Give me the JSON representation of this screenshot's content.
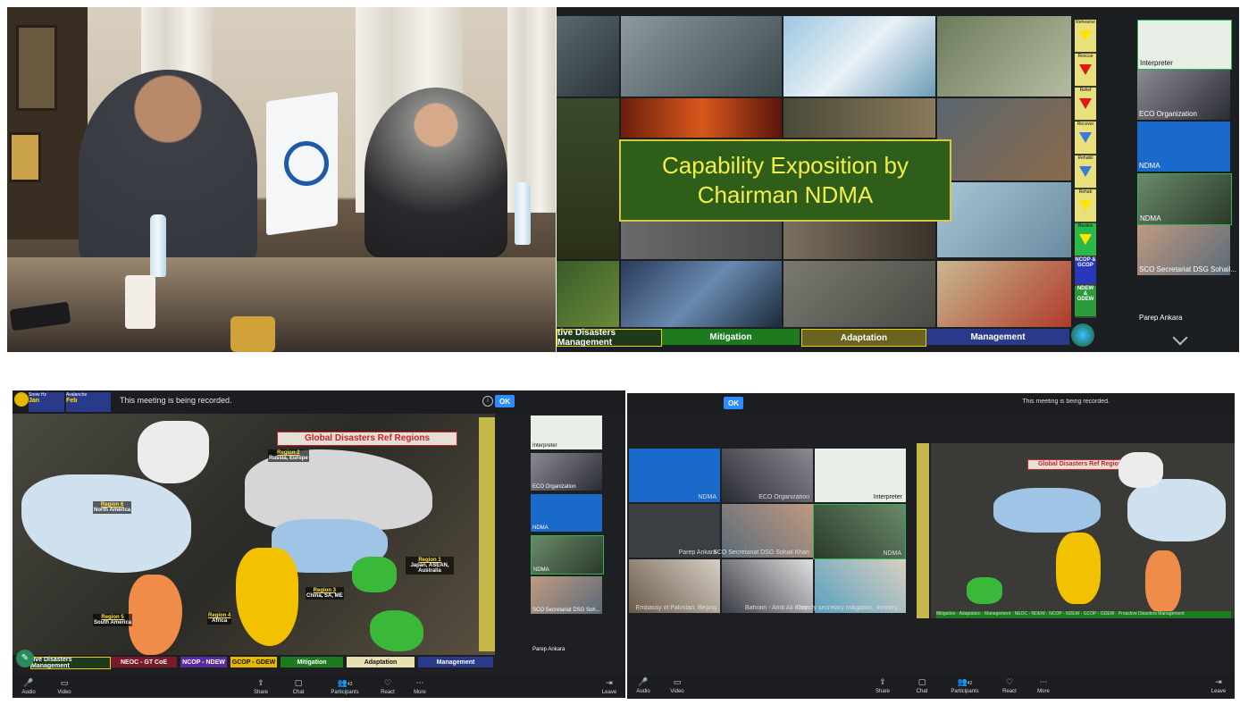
{
  "panel2": {
    "banner_line1": "Capability Exposition by",
    "banner_line2": "Chairman NDMA",
    "strip": [
      "Rehearse",
      "Rescue",
      "Relief",
      "Recover",
      "Rehabil",
      "Rehab",
      "Review",
      "NCOP & GCOP",
      "NDEW & GDEW"
    ],
    "categories": [
      "tive Disasters Management",
      "Mitigation",
      "Adaptation",
      "Management"
    ],
    "participants": [
      "Interpreter",
      "ECO Organization",
      "NDMA",
      "NDMA",
      "SCO Secretariat DSG Sohail...",
      "Parep Ankara"
    ]
  },
  "panel3": {
    "snow_label": "Snow Hz",
    "avalanche_label": "Avalanche",
    "month1": "Jan",
    "month2": "Feb",
    "recording_text": "This meeting is being recorded.",
    "ok_label": "OK",
    "map_title": "Global Disasters Ref Regions",
    "regions": [
      {
        "name": "Region 2",
        "desc": "Russia, Europe"
      },
      {
        "name": "Region 6",
        "desc": "North America"
      },
      {
        "name": "Region 1",
        "desc": "Japan, ASEAN, Australia"
      },
      {
        "name": "Region 3",
        "desc": "China, SA, ME"
      },
      {
        "name": "Region 5",
        "desc": "South America"
      },
      {
        "name": "Region 4",
        "desc": "Africa"
      }
    ],
    "bottom_categories": [
      "tive Disasters Management",
      "NEOC - GT CoE",
      "NCOP - NDEW",
      "GCOP - GDEW",
      "Mitigation",
      "Adaptation",
      "Management"
    ],
    "participants": [
      "Interpreter",
      "ECO Organization",
      "NDMA",
      "NDMA",
      "SCO Secretariat DSG Soh...",
      "Parep Ankara"
    ],
    "toolbar": {
      "audio": "Audio",
      "video": "Video",
      "share": "Share",
      "chat": "Chat",
      "participants": "Participants",
      "participants_count": "43",
      "react": "React",
      "more": "More",
      "leave": "Leave"
    }
  },
  "panel4": {
    "recording_text": "This meeting is being recorded.",
    "ok_label": "OK",
    "map_title": "Global Disasters Ref Regions",
    "tiles": [
      "NDMA",
      "ECO Organization",
      "Interpreter",
      "Parep Ankara",
      "SCO Secretariat DSG Sohail Khan",
      "NDMA",
      "Embassy of Pakistan, Beijing",
      "Bahrain - Amb Ali Khan",
      "Deputy secretary mitigation, ministry..."
    ],
    "bottom_categories": [
      "Mitigation",
      "Adaptation",
      "Management",
      "NEOC - NDEW",
      "NCOP - NDEW",
      "GCOP - GDEW",
      "Proactive Disasters Management"
    ],
    "toolbar": {
      "leave": "Leave",
      "more": "More",
      "react": "React",
      "participants": "Participants",
      "participants_count": "42",
      "chat": "Chat",
      "share": "Share",
      "video": "Video",
      "audio": "Audio"
    }
  },
  "colors": {
    "ok_blue": "#2d8cff",
    "banner_green": "#2f5d1a",
    "banner_text": "#f4ee4a",
    "zoom_dark": "#1d1f22"
  }
}
